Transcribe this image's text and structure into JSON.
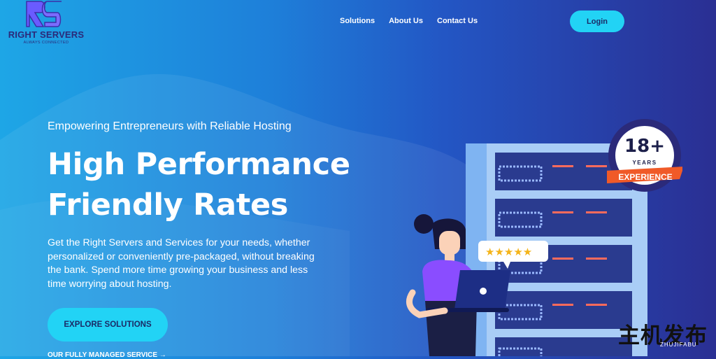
{
  "brand": {
    "name": "RIGHT SERVERS",
    "tagline": "ALWAYS CONNECTED"
  },
  "nav": {
    "items": [
      {
        "label": "Solutions"
      },
      {
        "label": "About Us"
      },
      {
        "label": "Contact Us"
      }
    ],
    "login_label": "Login"
  },
  "hero": {
    "kicker": "Empowering Entrepreneurs with Reliable Hosting",
    "title_line1": "High Performance",
    "title_line2": "Friendly Rates",
    "description": "Get the Right Servers and Services for your needs, whether personalized or conveniently pre-packaged, without breaking the bank. Spend more time growing your business and less time worrying about hosting.",
    "cta_label": "EXPLORE SOLUTIONS",
    "secondary_link": "OUR FULLY MANAGED SERVICE →"
  },
  "badge": {
    "number": "18+",
    "unit": "YEARS",
    "ribbon": "EXPERIENCE"
  },
  "rating": {
    "stars": 5
  },
  "watermark": {
    "text": "主机发布",
    "sub": "ZHUJIFABU"
  },
  "colors": {
    "accent": "#22d3f5",
    "ribbon": "#f05a28",
    "brand_dark": "#2b2a7a"
  }
}
